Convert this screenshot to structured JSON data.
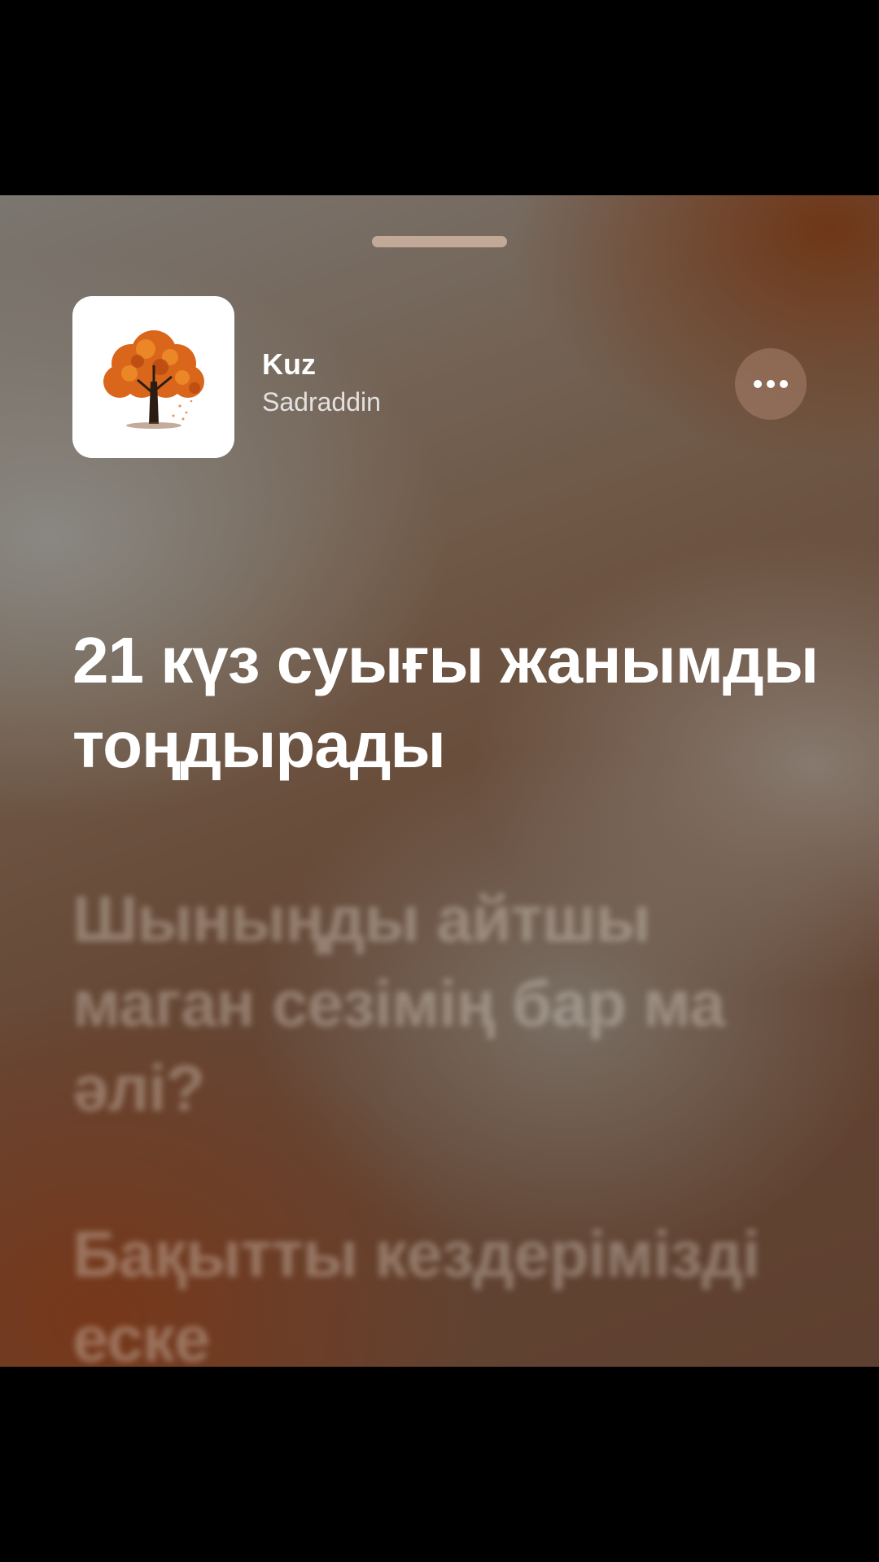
{
  "track": {
    "title": "Kuz",
    "artist": "Sadraddin"
  },
  "lyrics": {
    "current": "21 күз суығы жанымды тоңдырады",
    "next": "Шыныңды айтшы маган сезімің бар ма әлі?",
    "upcoming": "Бақытты кездерімізді еске"
  },
  "icons": {
    "more": "ellipsis-icon",
    "artwork": "autumn-tree-icon"
  },
  "colors": {
    "background_warm": "#6b4a36",
    "background_grey": "#7b7670",
    "accent_rust": "#6e3414",
    "text_primary": "#ffffff"
  }
}
